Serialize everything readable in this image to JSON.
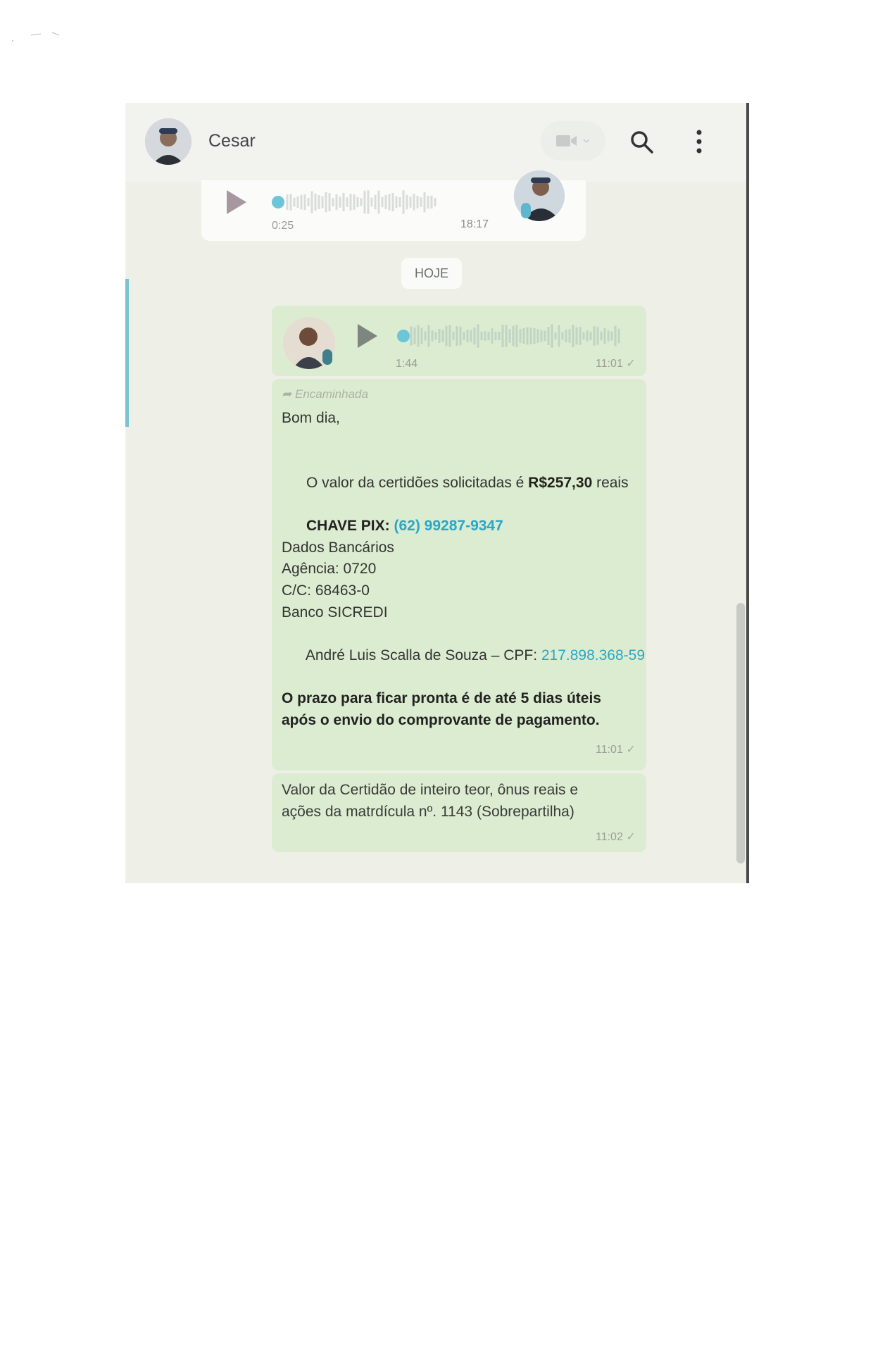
{
  "contact": {
    "name": "Cesar"
  },
  "received_audio": {
    "duration": "0:25",
    "time": "18:17"
  },
  "day_separator": "HOJE",
  "sent_audio": {
    "duration": "1:44",
    "time": "11:01"
  },
  "message1": {
    "forwarded_label": "Encaminhada",
    "greeting": "Bom dia,",
    "value_text": "O valor da certidões solicitadas é ",
    "value_amount": "R$257,30",
    "value_suffix": " reais",
    "pix_label": "CHAVE PIX:",
    "pix_value": "(62) 99287-9347",
    "bank_title": "Dados Bancários",
    "agency": "Agência: 0720",
    "account": "C/C: 68463-0",
    "bank": "Banco SICREDI",
    "holder": "André Luis Scalla de Souza – CPF: ",
    "cpf": "217.898.368-59",
    "deadline_line1": "O prazo para ficar pronta é de até 5 dias úteis",
    "deadline_line2": "após o envio do comprovante de pagamento.",
    "time": "11:01"
  },
  "message2": {
    "line1": "Valor da Certidão de inteiro teor, ônus reais e",
    "line2": "ações da matrdícula nº. 1143 (Sobrepartilha)",
    "time": "11:02"
  },
  "icons": [
    "video-icon",
    "chevron-down-icon",
    "search-icon",
    "menu-icon",
    "play-icon",
    "mic-icon",
    "forward-icon",
    "check-icon"
  ]
}
